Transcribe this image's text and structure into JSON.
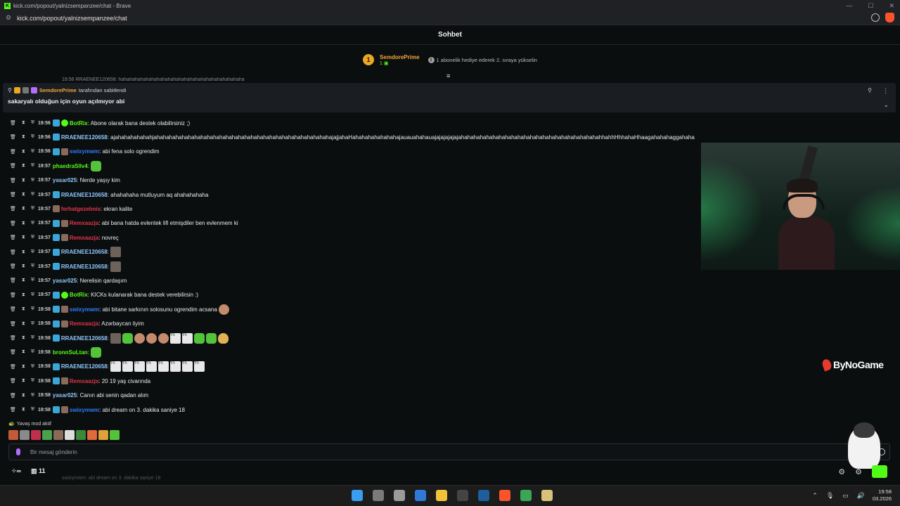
{
  "window": {
    "title": "kick.com/popout/yalnizsempanzee/chat - Brave",
    "url": "kick.com/popout/yalnizsempanzee/chat"
  },
  "chat": {
    "header": "Sohbet",
    "leaderboard": {
      "rank": "1",
      "user": "SemdorePrime",
      "count": "1",
      "note": "1 abonelik hediye ederek 2. sıraya yükselin"
    },
    "partial_row": "19:56 RRAENEE120658: hahahahahahahahahahahahahahahahahahahahahahaha",
    "pinned": {
      "by_user": "SemdorePrime",
      "by_text": "tarafından sabitlendi",
      "message": "sakaryalı olduğun için oyun açılmıyor abi"
    },
    "messages": [
      {
        "time": "19:56",
        "user": "BotRix",
        "text": ": Abone olarak bana destek olabilirsiniz ;)",
        "color": "#53fc18"
      },
      {
        "time": "19:56",
        "user": "RRAENEE120658",
        "text": ": ajahahahahahahjahahahahahahahahahahahahahahahahahahahahahahahahahahahahajajjahaHahahahahahahahajauauahahauajajajajajajahahahahahahahahahahahahahahahahahahahahahahahhahhHhhahaHhaagahahahaggahaha",
        "color": "#8ec9ff"
      },
      {
        "time": "19:56",
        "user": "swixymwm",
        "text": ": abi fena solo ogrendim",
        "color": "#2f7bff"
      },
      {
        "time": "19:57",
        "user": "phaedraSllv4",
        "text": ":",
        "color": "#53fc18"
      },
      {
        "time": "19:57",
        "user": "yasar025",
        "text": ": Nerde yaşıy kim",
        "color": "#8ec9ff"
      },
      {
        "time": "19:57",
        "user": "RRAENEE120658",
        "text": ": ahahahaha mutluyum aq ahahahahaha",
        "color": "#8ec9ff"
      },
      {
        "time": "19:57",
        "user": "ferhatgezelmis",
        "text": ": ekran kalite",
        "color": "#e0354b"
      },
      {
        "time": "19:57",
        "user": "Remxaazja",
        "text": ": abi bana hatda evlentek lifi etmişdiler ben evlenmem ki",
        "color": "#e0354b"
      },
      {
        "time": "19:57",
        "user": "Remxaazja",
        "text": ": novreç",
        "color": "#e0354b"
      },
      {
        "time": "19:57",
        "user": "RRAENEE120658",
        "text": ":",
        "color": "#8ec9ff"
      },
      {
        "time": "19:57",
        "user": "RRAENEE120658",
        "text": ":",
        "color": "#8ec9ff"
      },
      {
        "time": "19:57",
        "user": "yasar025",
        "text": ": Nerelisin qardaşım",
        "color": "#8ec9ff"
      },
      {
        "time": "19:57",
        "user": "BotRix",
        "text": ": KICKs kulanarak bana destek verebilirsin :)",
        "color": "#53fc18"
      },
      {
        "time": "19:58",
        "user": "swixymwm",
        "text": ": abi bitane sarkının solosunu ogrendim acsana",
        "color": "#2f7bff"
      },
      {
        "time": "19:58",
        "user": "Remxaazja",
        "text": ": Azərbaycan liyim",
        "color": "#e0354b"
      },
      {
        "time": "19:58",
        "user": "RRAENEE120658",
        "text": ":",
        "color": "#8ec9ff"
      },
      {
        "time": "19:58",
        "user": "bronnSuLtan",
        "text": ":",
        "color": "#53fc18"
      },
      {
        "time": "19:58",
        "user": "RRAENEE120658",
        "text": ":",
        "color": "#8ec9ff"
      },
      {
        "time": "19:58",
        "user": "Remxaazja",
        "text": ": 20 19 yaş civarında",
        "color": "#e0354b"
      },
      {
        "time": "19:58",
        "user": "yasar025",
        "text": ": Canın abi senin qadan alım",
        "color": "#8ec9ff"
      },
      {
        "time": "19:58",
        "user": "swixymwm",
        "text": ": abi dream on 3. dakika saniye 18",
        "color": "#2f7bff"
      }
    ],
    "slow_mode": "Yavaş mod aktif",
    "input_placeholder": "Bir mesaj gönderin",
    "bottom": {
      "viewers": "11"
    },
    "under_text": "swixymwm: abi dream on 3. dakika saniye 18"
  },
  "overlay": {
    "logo": "ByNoGame"
  },
  "taskbar": {
    "time": "19:58",
    "date": "03.2026"
  },
  "colors": {
    "accent": "#53fc18",
    "background": "#0b0e0f"
  }
}
